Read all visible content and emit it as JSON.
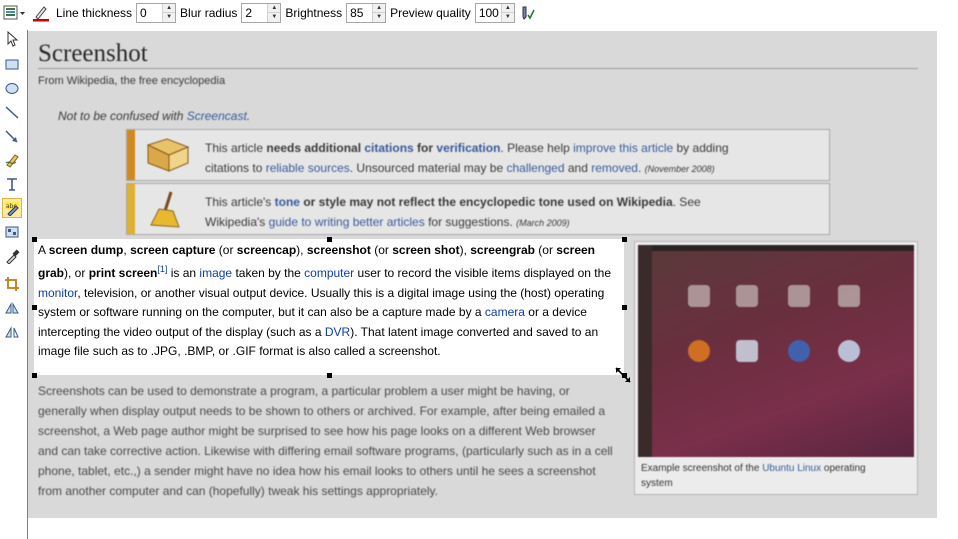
{
  "toolbar": {
    "line_thickness_label": "Line thickness",
    "line_thickness_value": "0",
    "blur_radius_label": "Blur radius",
    "blur_radius_value": "2",
    "brightness_label": "Brightness",
    "brightness_value": "85",
    "preview_quality_label": "Preview quality",
    "preview_quality_value": "100",
    "line_color": "#cc0000"
  },
  "left_tools": [
    {
      "name": "select-tool"
    },
    {
      "name": "rectangle-tool"
    },
    {
      "name": "ellipse-tool"
    },
    {
      "name": "line-tool"
    },
    {
      "name": "arrow-tool"
    },
    {
      "name": "freehand-tool"
    },
    {
      "name": "text-tool"
    },
    {
      "name": "highlight-tool"
    },
    {
      "name": "obfuscate-tool"
    },
    {
      "name": "pipette-tool"
    },
    {
      "name": "crop-tool"
    },
    {
      "name": "flip-tool"
    },
    {
      "name": "rotate-tool"
    }
  ],
  "wiki": {
    "title": "Screenshot",
    "subtitle": "From Wikipedia, the free encyclopedia",
    "hatnote_prefix": "Not to be confused with ",
    "hatnote_link": "Screencast",
    "hatnote_suffix": ".",
    "box1": {
      "t1": "This article ",
      "t2": "needs additional ",
      "t3": "citations",
      "t4": " for ",
      "t5": "verification",
      "t6": ". Please help ",
      "t7": "improve this article",
      "t8": " by adding",
      "t9": "citations to ",
      "t10": "reliable sources",
      "t11": ". Unsourced material may be ",
      "t12": "challenged",
      "t13": " and ",
      "t14": "removed",
      "t15": ". ",
      "date": "(November 2008)"
    },
    "box2": {
      "t1": "This article's ",
      "t2": "tone",
      "t3": " or style may not reflect the encyclopedic tone used on Wikipedia",
      "t4": ". See",
      "t5": "Wikipedia's ",
      "t6": "guide to writing better articles",
      "t7": " for suggestions. ",
      "date": "(March 2009)"
    },
    "paragraph2": "Screenshots can be used to demonstrate a program, a particular problem a user might be having, or generally when display output needs to be shown to others or archived. For example, after being emailed a screenshot, a Web page author might be surprised to see how his page looks on a different Web browser and can take corrective action. Likewise with differing email software programs, (particularly such as in a cell phone, tablet, etc.,) a sender might have no idea how his email looks to others until he sees a screenshot from another computer and can (hopefully) tweak his settings appropriately.",
    "thumb_caption_prefix": "Example screenshot of the ",
    "thumb_caption_link": "Ubuntu Linux",
    "thumb_caption_suffix": " operating system"
  },
  "selection": {
    "s1": "A ",
    "s2": "screen dump",
    "s3": ", ",
    "s4": "screen capture",
    "s5": " (or ",
    "s6": "screencap",
    "s7": "), ",
    "s8": "screenshot",
    "s9": " (or ",
    "s10": "screen shot",
    "s11": "), ",
    "s12": "screengrab",
    "s13": " (or",
    "s14": "screen grab",
    "s15": "), or ",
    "s16": "print screen",
    "s17": "[1]",
    "s18": " is an ",
    "s19": "image",
    "s20": " taken by the ",
    "s21": "computer",
    "s22": " user to record the visible items displayed on the ",
    "s23": "monitor",
    "s24": ", television, or another visual output device. Usually this is a digital image using the (host) operating system or software running on the computer, but it can also be a capture made by a ",
    "s25": "camera",
    "s26": " or a device intercepting the video output of the display (such as a ",
    "s27": "DVR",
    "s28": "). That latent image converted and saved to an image file such as to .JPG, .BMP, or .GIF format is also called a screenshot."
  }
}
